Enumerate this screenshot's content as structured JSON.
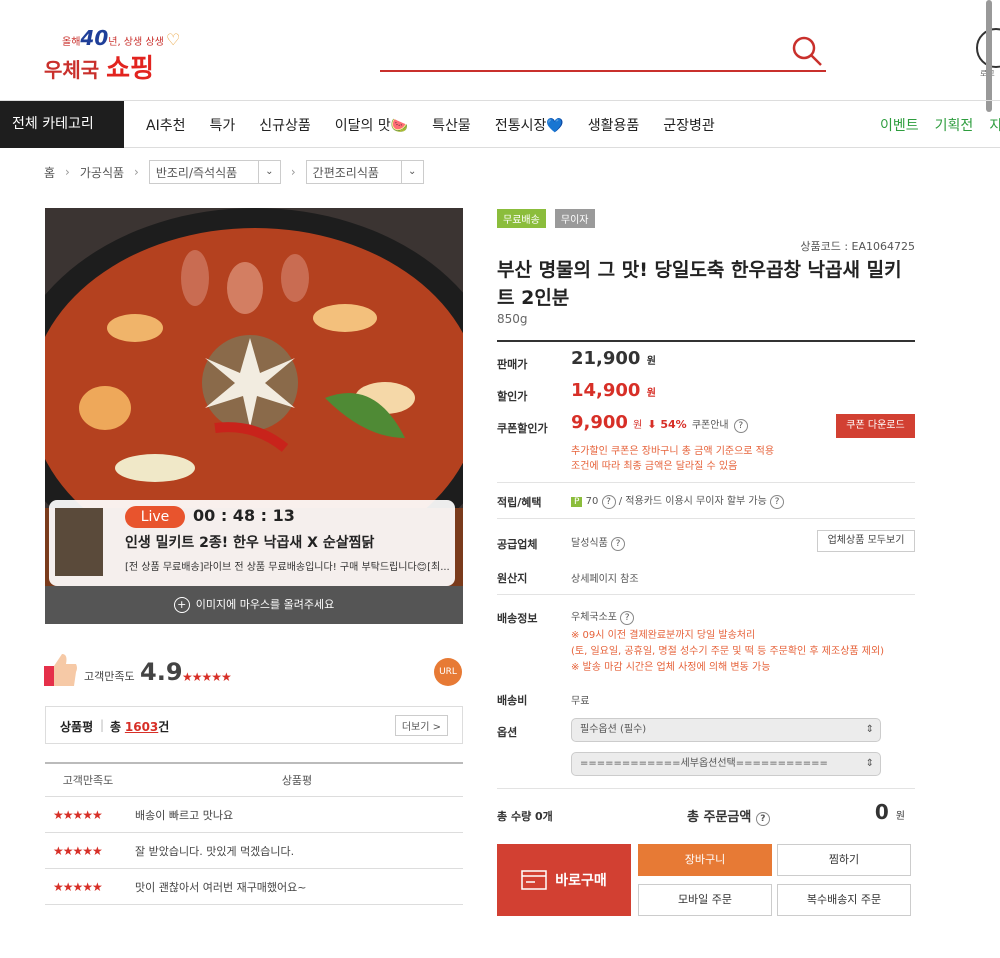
{
  "logo": {
    "anniv_prefix": "올해",
    "anniv_num": "40",
    "anniv_suffix": "년, 상생 상생",
    "brand_a": "우체국",
    "brand_b": "쇼핑"
  },
  "header": {
    "right_label": "로그"
  },
  "nav": {
    "all_category": "전체 카테고리",
    "items": [
      "AI추천",
      "특가",
      "신규상품",
      "이달의 맛🍉",
      "특산물",
      "전통시장💙",
      "생활용품",
      "군장병관"
    ],
    "right_items": [
      "이벤트",
      "기획전",
      "지역"
    ]
  },
  "breadcrumb": {
    "home": "홈",
    "level1": "가공식품",
    "level2": "반조리/즉석식품",
    "level3": "간편조리식품"
  },
  "image": {
    "live_badge": "Live",
    "live_time": "00 : 48 : 13",
    "live_title": "인생 밀키트 2종! 한우 낙곱새 X 순살찜닭",
    "live_desc": "[전 상품 무료배송]라이브 전 상품 무료배송입니다! 구매 부탁드립니다😊[최...",
    "hover_hint": "이미지에 마우스를 올려주세요"
  },
  "rating": {
    "label": "고객만족도",
    "score": "4.9",
    "stars": "★★★★★",
    "url_badge": "URL"
  },
  "reviews": {
    "title": "상품평",
    "total_label": "총",
    "total_count": "1603",
    "count_suffix": "건",
    "more": "더보기 >",
    "col_satisfaction": "고객만족도",
    "col_review": "상품평",
    "rows": [
      {
        "stars": "★★★★★",
        "text": "배송이 빠르고 맛나요"
      },
      {
        "stars": "★★★★★",
        "text": "잘 받았습니다. 맛있게 먹겠습니다."
      },
      {
        "stars": "★★★★★",
        "text": "맛이 괜찮아서 여러번 재구매했어요~"
      }
    ]
  },
  "product": {
    "tags": [
      "무료배송",
      "무이자"
    ],
    "tag_colors": [
      "#8bbd3c",
      "#9a9a9a"
    ],
    "code": "상품코드 : EA1064725",
    "title": "부산 명물의 그 맛! 당일도축 한우곱창 낙곱새 밀키트 2인분",
    "weight": "850g",
    "price_label": "판매가",
    "price": "21,900",
    "won": "원",
    "sale_label": "할인가",
    "sale_price": "14,900",
    "coupon_label": "쿠폰할인가",
    "coupon_price": "9,900",
    "discount": "⬇ 54%",
    "coupon_info": "쿠폰안내",
    "coupon_download": "쿠폰 다운로드",
    "coupon_note_1": "추가할인 쿠폰은 장바구니 총 금액 기준으로 적용",
    "coupon_note_2": "조건에 따라 최종 금액은 달라질 수 있음",
    "point_label": "적립/혜택",
    "point_badge": "P",
    "point_value": "70",
    "point_slash": "/",
    "card_benefit": "적용카드 이용시 무이자 할부 가능",
    "seller_label": "공급업체",
    "seller": "달성식품",
    "seller_all": "업체상품 모두보기",
    "origin_label": "원산지",
    "origin": "상세페이지 참조",
    "ship_label": "배송정보",
    "ship_method": "우체국소포",
    "ship_note_1": "※ 09시 이전 결제완료분까지 당일 발송처리",
    "ship_note_2": "(토, 일요일, 공휴일, 명절 성수기 주문 및 떡 등 주문확인 후 제조상품 제외)",
    "ship_note_3": "※ 발송 마감 시간은 업체 사정에 의해 변동 가능",
    "fee_label": "배송비",
    "fee": "무료",
    "option_label": "옵션",
    "option_1": "필수옵션 (필수)",
    "option_2": "============세부옵션선택===========",
    "total_qty": "총 수량 0개",
    "total_amount_label": "총 주문금액",
    "total_amount": "0",
    "total_won": "원"
  },
  "actions": {
    "buy_now": "바로구매",
    "cart": "장바구니",
    "wish": "찜하기",
    "mobile": "모바일 주문",
    "multi": "복수배송지 주문"
  },
  "colors": {
    "brand_red": "#d24032",
    "orange": "#e77a35",
    "green": "#2e9d3e",
    "price_red": "#d72f27"
  }
}
